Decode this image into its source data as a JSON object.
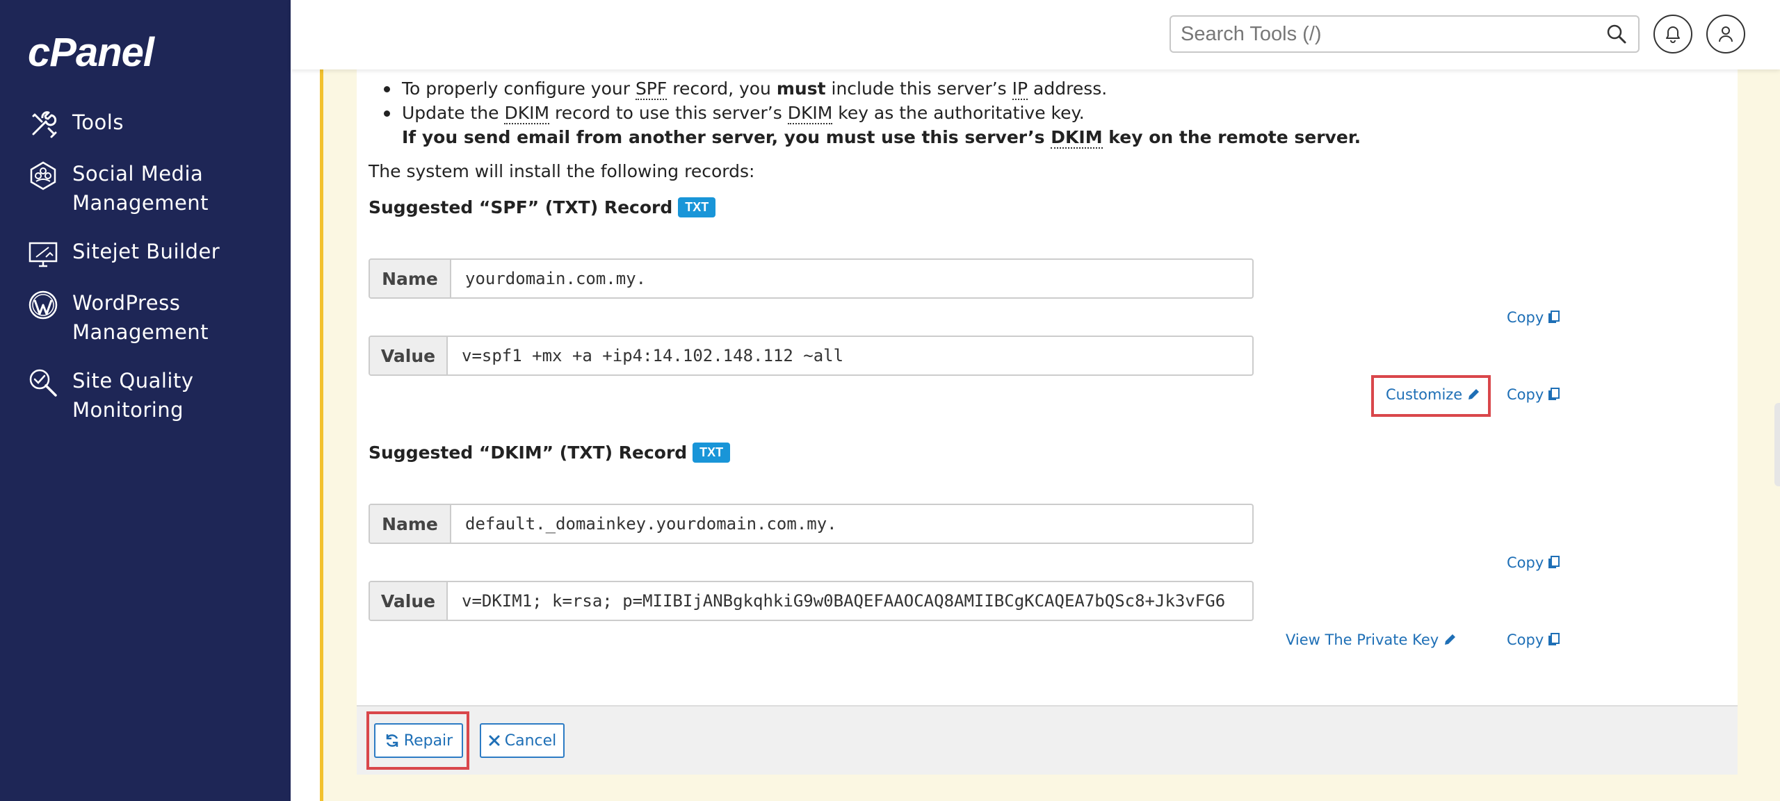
{
  "brand": {
    "logo_text": "cPanel"
  },
  "sidebar": {
    "items": [
      {
        "label": "Tools",
        "icon": "tools-icon"
      },
      {
        "label": "Social Media\nManagement",
        "line1": "Social Media",
        "line2": "Management",
        "icon": "social-media-icon"
      },
      {
        "label": "Sitejet Builder",
        "icon": "sitejet-icon"
      },
      {
        "label": "WordPress\nManagement",
        "line1": "WordPress",
        "line2": "Management",
        "icon": "wordpress-icon"
      },
      {
        "label": "Site Quality\nMonitoring",
        "line1": "Site Quality",
        "line2": "Monitoring",
        "icon": "site-quality-icon"
      }
    ]
  },
  "header": {
    "search_placeholder": "Search Tools (/)",
    "icons": [
      "search-icon",
      "bell-icon",
      "user-icon"
    ]
  },
  "instructions": {
    "bullet1_pre": "To properly configure your ",
    "bullet1_abbr1": "SPF",
    "bullet1_mid": " record, you ",
    "bullet1_must": "must",
    "bullet1_mid2": " include this server’s ",
    "bullet1_abbr2": "IP",
    "bullet1_post": " address.",
    "bullet2_pre": "Update the ",
    "bullet2_abbr1": "DKIM",
    "bullet2_mid": " record to use this server’s ",
    "bullet2_abbr2": "DKIM",
    "bullet2_post": " key as the authoritative key.",
    "bullet2_bold_pre": "If you send email from another server, you must use this server’s ",
    "bullet2_bold_abbr": "DKIM",
    "bullet2_bold_post": " key on the remote server.",
    "install_text": "The system will install the following records:"
  },
  "spf": {
    "title": "Suggested “SPF” (TXT) Record",
    "badge": "TXT",
    "name_label": "Name",
    "name_value": "yourdomain.com.my.",
    "value_label": "Value",
    "value_value": "v=spf1 +mx +a +ip4:14.102.148.112 ~all",
    "copy_label": "Copy",
    "customize_label": "Customize"
  },
  "dkim": {
    "title": "Suggested “DKIM” (TXT) Record",
    "badge": "TXT",
    "name_label": "Name",
    "name_value": "default._domainkey.yourdomain.com.my.",
    "value_label": "Value",
    "value_value": "v=DKIM1; k=rsa; p=MIIBIjANBgkqhkiG9w0BAQEFAAOCAQ8AMIIBCgKCAQEA7bQSc8+Jk3vFG6",
    "copy_label": "Copy",
    "private_key_label": "View The Private Key"
  },
  "actions": {
    "repair_label": "Repair",
    "cancel_label": "Cancel"
  },
  "colors": {
    "sidebar_bg": "#1e2656",
    "accent_blue": "#1e6fb6",
    "badge_blue": "#1995d8",
    "highlight_red": "#d9474b",
    "warning_yellow": "#f2c12e"
  }
}
